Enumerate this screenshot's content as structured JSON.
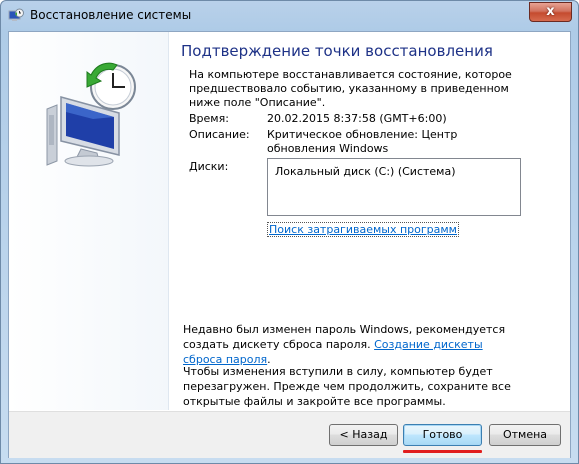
{
  "window": {
    "title": "Восстановление системы",
    "close_symbol": "x"
  },
  "content": {
    "heading": "Подтверждение точки восстановления",
    "intro": "На компьютере восстанавливается состояние, которое предшествовало событию, указанному в приведенном ниже поле \"Описание\".",
    "time_label": "Время:",
    "time_value": "20.02.2015 8:37:58 (GMT+6:00)",
    "description_label": "Описание:",
    "description_value": "Критическое обновление: Центр обновления Windows",
    "disks_label": "Диски:",
    "disks_value": "Локальный диск (C:) (Система)",
    "scan_link": "Поиск затрагиваемых программ",
    "password_note": "Недавно был изменен пароль Windows, рекомендуется создать дискету сброса пароля.",
    "password_link": "Создание дискеты сброса пароля",
    "password_period": ".",
    "restart_note": "Чтобы изменения вступили в силу, компьютер будет перезагружен. Прежде чем продолжить, сохраните все открытые файлы и закройте все программы."
  },
  "buttons": {
    "back": "< Назад",
    "finish": "Готово",
    "cancel": "Отмена"
  },
  "icons": {
    "window": "system-restore-icon",
    "hero": "system-restore-hero-icon",
    "close": "close-icon"
  },
  "colors": {
    "heading": "#1e3287",
    "link": "#0066cc",
    "highlight_underline": "#e11d1d",
    "close_button": "#c54b2f"
  }
}
